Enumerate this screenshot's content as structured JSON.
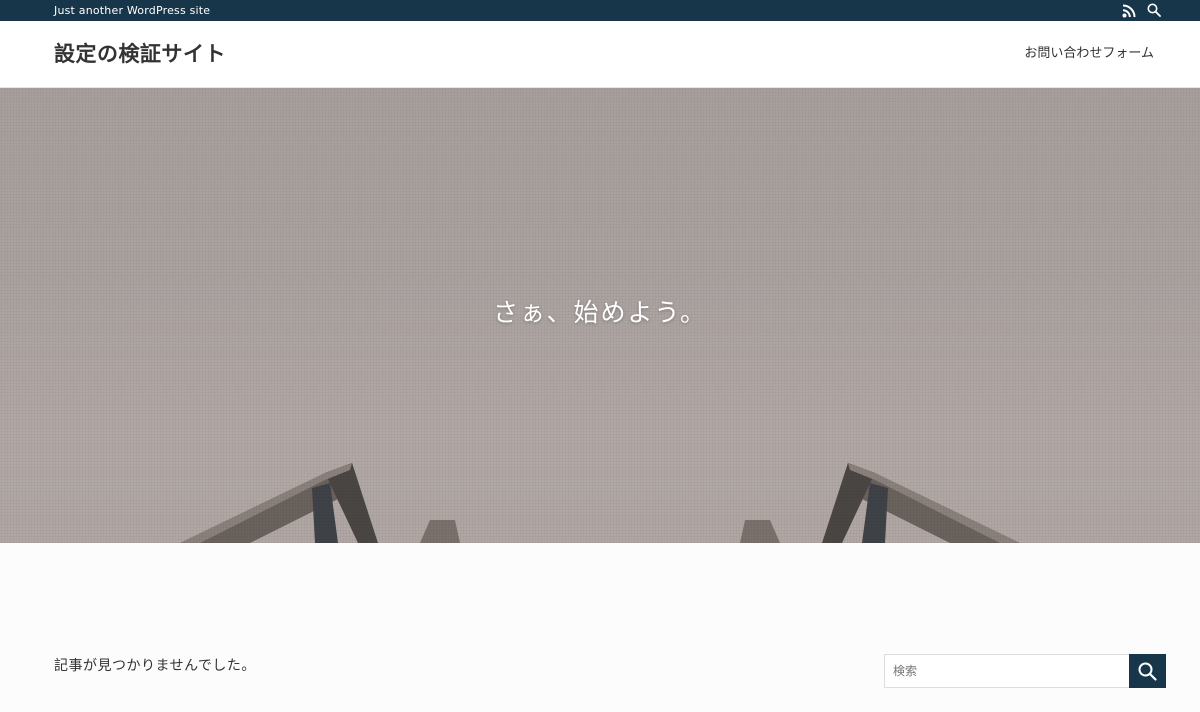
{
  "topbar": {
    "tagline": "Just another WordPress site",
    "icons": [
      "rss-icon",
      "search-icon"
    ],
    "bg_color": "#17364a"
  },
  "header": {
    "site_title": "設定の検証サイト",
    "nav": [
      {
        "label": "お問い合わせフォーム"
      }
    ]
  },
  "hero": {
    "headline": "さぁ、始めよう。"
  },
  "main": {
    "message": "記事が見つかりませんでした。"
  },
  "sidebar": {
    "search": {
      "placeholder": "検索",
      "value": "",
      "button_icon": "search-icon"
    }
  },
  "colors": {
    "accent": "#17364a",
    "text": "#333333"
  }
}
